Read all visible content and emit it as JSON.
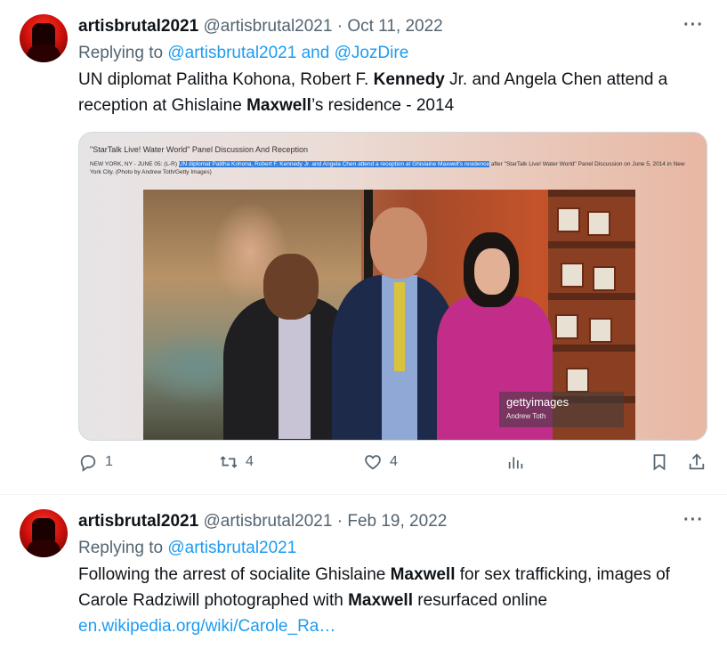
{
  "tweets": [
    {
      "user": {
        "name": "artisbrutal2021",
        "handle": "@artisbrutal2021"
      },
      "dot": "·",
      "date": "Oct 11, 2022",
      "replying_prefix": "Replying to ",
      "replying_to": "@artisbrutal2021 and @JozDire",
      "text_segments": [
        "UN diplomat Palitha Kohona, Robert F. ",
        "Kennedy",
        " Jr. and Angela Chen attend a reception at Ghislaine ",
        "Maxwell",
        "’s residence - 2014"
      ],
      "media": {
        "title": "\"StarTalk Live! Water World\" Panel Discussion And Reception",
        "caption_prefix": "NEW YORK, NY - JUNE 05: (L-R) ",
        "caption_highlight": "UN diplomat Palitha Kohona, Robert F. Kennedy Jr. and Angela Chen attend a reception at Ghislaine Maxwell's residence",
        "caption_suffix": " after \"StarTalk Live! Water World\" Panel Discussion on June 5, 2014 in New York City. (Photo by Andrew Toth/Getty Images)",
        "watermark_brand": "gettyimages",
        "watermark_credit": "Andrew Toth"
      },
      "actions": {
        "reply_count": "1",
        "retweet_count": "4",
        "like_count": "4"
      },
      "more_label": "···"
    },
    {
      "user": {
        "name": "artisbrutal2021",
        "handle": "@artisbrutal2021"
      },
      "dot": "·",
      "date": "Feb 19, 2022",
      "replying_prefix": "Replying to ",
      "replying_to": "@artisbrutal2021",
      "text_segments": [
        "Following the arrest of socialite Ghislaine ",
        "Maxwell",
        " for sex trafficking, images of Carole Radziwill photographed with ",
        "Maxwell",
        " resurfaced online"
      ],
      "link": "en.wikipedia.org/wiki/Carole_Ra…",
      "more_label": "···"
    }
  ],
  "icons": {
    "reply": "reply-icon",
    "retweet": "retweet-icon",
    "like": "heart-icon",
    "views": "analytics-icon",
    "bookmark": "bookmark-icon",
    "share": "share-icon"
  },
  "colors": {
    "link": "#1d9bf0",
    "secondary": "#536471",
    "text": "#0f1419"
  }
}
